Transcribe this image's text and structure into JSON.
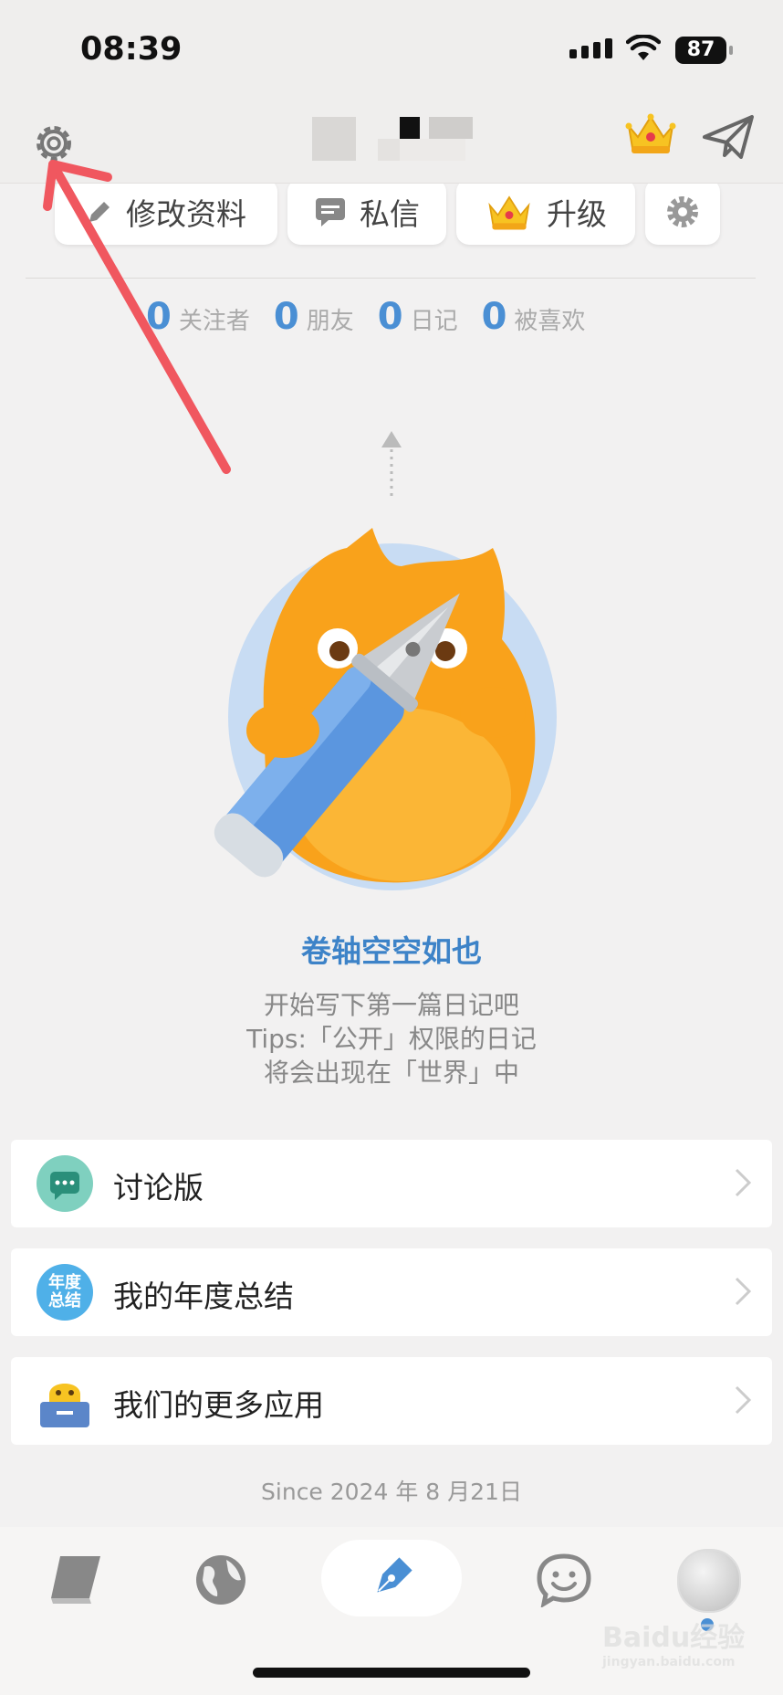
{
  "status_bar": {
    "time": "08:39",
    "battery": "87"
  },
  "header": {
    "settings_icon": "gear-icon",
    "vip_icon": "crown-icon",
    "send_icon": "paper-plane-icon"
  },
  "actions": [
    {
      "label": "修改资料",
      "icon": "pencil-icon"
    },
    {
      "label": "私信",
      "icon": "message-icon"
    },
    {
      "label": "升级",
      "icon": "crown-icon"
    },
    {
      "label": "",
      "icon": "gear-icon"
    }
  ],
  "stats": [
    {
      "value": "0",
      "label": "关注者"
    },
    {
      "value": "0",
      "label": "朋友"
    },
    {
      "value": "0",
      "label": "日记"
    },
    {
      "value": "0",
      "label": "被喜欢"
    }
  ],
  "empty_state": {
    "title": "卷轴空空如也",
    "line1": "开始写下第一篇日记吧",
    "line2": "Tips:「公开」权限的日记",
    "line3": "将会出现在「世界」中"
  },
  "menu": [
    {
      "label": "讨论版",
      "icon": "chat-bubble-icon",
      "color": "#5fc6b3"
    },
    {
      "label": "我的年度总结",
      "icon": "annual-summary-icon",
      "color": "#4fb0e8",
      "icon_text": "年度总结"
    },
    {
      "label": "我们的更多应用",
      "icon": "more-apps-icon",
      "color": "#6a9ee0"
    }
  ],
  "since": "Since 2024 年 8 月21日",
  "tabs": [
    {
      "name": "diary-book-icon"
    },
    {
      "name": "globe-icon"
    },
    {
      "name": "pen-icon",
      "active": true
    },
    {
      "name": "smiley-icon"
    },
    {
      "name": "avatar"
    }
  ],
  "watermark": {
    "brand": "Baidu经验",
    "url": "jingyan.baidu.com"
  },
  "colors": {
    "accent_blue": "#4a8fd4",
    "annotation_red": "#f0575f",
    "mascot_orange": "#f9a21b"
  }
}
